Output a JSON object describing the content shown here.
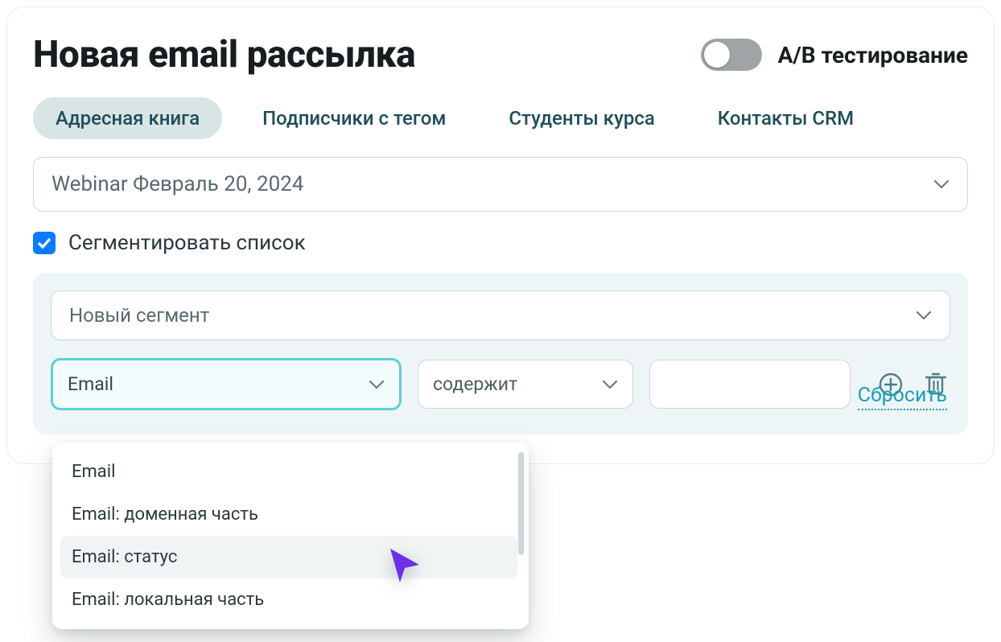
{
  "header": {
    "title": "Новая email рассылка",
    "ab_label": "A/B тестирование",
    "ab_enabled": false
  },
  "tabs": [
    {
      "id": "address-book",
      "label": "Адресная книга",
      "active": true
    },
    {
      "id": "subscribers-tag",
      "label": "Подписчики с тегом",
      "active": false
    },
    {
      "id": "course-students",
      "label": "Студенты курса",
      "active": false
    },
    {
      "id": "crm-contacts",
      "label": "Контакты CRM",
      "active": false
    }
  ],
  "list_select": {
    "value": "Webinar Февраль 20, 2024"
  },
  "segment": {
    "checkbox_label": "Сегментировать список",
    "checked": true,
    "segment_select": "Новый сегмент",
    "filter": {
      "field": "Email",
      "operator": "содержит",
      "value": ""
    },
    "reset_label": "Сбросить"
  },
  "field_dropdown": {
    "items": [
      {
        "label": "Email",
        "highlighted": false
      },
      {
        "label": "Email: доменная часть",
        "highlighted": false
      },
      {
        "label": "Email: статус",
        "highlighted": true
      },
      {
        "label": "Email: локальная часть",
        "highlighted": false
      }
    ]
  },
  "colors": {
    "accent_focus": "#5ecfd6",
    "link": "#16a0bb",
    "checkbox": "#0a7bff",
    "cursor": "#6e2fe8"
  }
}
